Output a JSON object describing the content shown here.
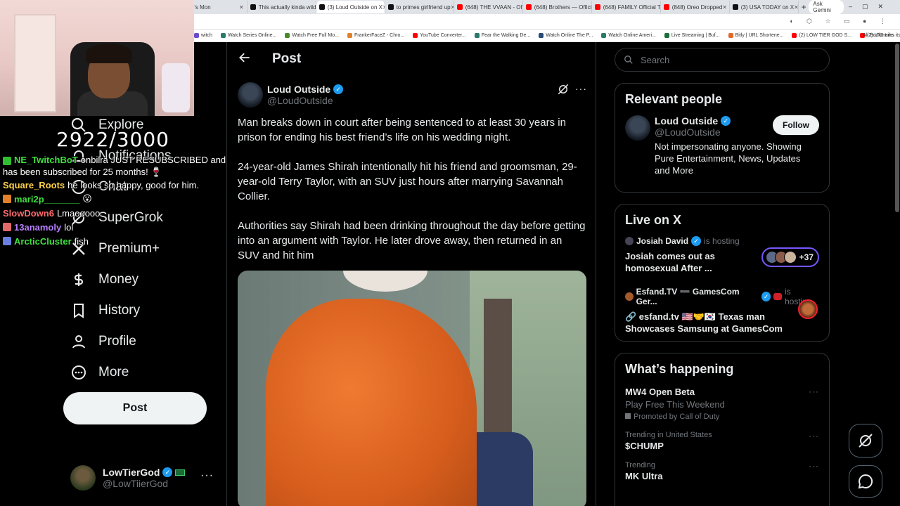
{
  "browser": {
    "tabs": [
      {
        "label": "...'s Mon",
        "color": "#555555"
      },
      {
        "label": "This actually kinda wild",
        "color": "#111111"
      },
      {
        "label": "(3) Loud Outside on X",
        "color": "#111111"
      },
      {
        "label": "to primes girlfriend up",
        "color": "#111111"
      },
      {
        "label": "(648) THE VVAAN - Offi",
        "color": "#ff0000"
      },
      {
        "label": "(648) Brothers — Offici",
        "color": "#ff0000"
      },
      {
        "label": "(648) FAMILY Official Tr",
        "color": "#ff0000"
      },
      {
        "label": "(848) Oreo Dropped",
        "color": "#ff0000"
      },
      {
        "label": "(3) USA TODAY on X",
        "color": "#111111"
      }
    ],
    "ask_gemini": "Ask Gemini",
    "bookmarks": [
      "witch",
      "Watch Series Online...",
      "Watch Free Full Mo...",
      "FrankerFaceZ - Chro...",
      "YouTube Converter...",
      "Fear the Walking De...",
      "Watch Online The P...",
      "Watch Online Ameri...",
      "Live Streaming | Buf...",
      "Bitly | URL Shortene...",
      "(2) LOW TIER GOD S...",
      "(2) LTG tries itslowly..."
    ],
    "all_bookmarks": "All Bookmarks"
  },
  "overlay": {
    "sub_goal": "2922/3000",
    "chat": [
      {
        "user": "NE_TwitchBoT",
        "user_color": "#3fe03f",
        "badge_color": "#2fbf2f",
        "message": "onbilra JUST RESUBSCRIBED and has been subscribed for 25 months! 🍷"
      },
      {
        "user": "Square_Roots",
        "user_color": "#ffd24a",
        "badge_color": "",
        "message": "he looks so happy, good for him."
      },
      {
        "user": "mari2p_______",
        "user_color": "#3fe03f",
        "badge_color": "#e0802a",
        "message": "😮"
      },
      {
        "user": "SlowDown6",
        "user_color": "#ff6b6b",
        "badge_color": "",
        "message": "Lmaooooo"
      },
      {
        "user": "13anamoly",
        "user_color": "#b87fff",
        "badge_color": "#e06a6a",
        "message": "lol"
      },
      {
        "user": "ArcticCluster",
        "user_color": "#3fe03f",
        "badge_color": "#6a7fe0",
        "message": "fish"
      }
    ]
  },
  "nav": {
    "items": [
      {
        "label": "Explore",
        "icon": "search-icon"
      },
      {
        "label": "Notifications",
        "icon": "bell-icon",
        "badge": "3"
      },
      {
        "label": "Chat",
        "icon": "chat-icon"
      },
      {
        "label": "SuperGrok",
        "icon": "grok-icon"
      },
      {
        "label": "Premium+",
        "icon": "x-icon"
      },
      {
        "label": "Money",
        "icon": "money-icon"
      },
      {
        "label": "History",
        "icon": "bookmark-icon"
      },
      {
        "label": "Profile",
        "icon": "person-icon"
      },
      {
        "label": "More",
        "icon": "more-circle-icon"
      }
    ],
    "post_label": "Post",
    "account": {
      "name": "LowTierGod",
      "handle": "@LowTiierGod"
    }
  },
  "main": {
    "title": "Post",
    "post": {
      "author_name": "Loud Outside",
      "author_handle": "@LoudOutside",
      "paragraphs": [
        "Man breaks down in court after being sentenced to at least 30 years in prison for ending his best friend’s life on his wedding night.",
        "24-year-old James Shirah intentionally hit his friend and groomsman, 29-year-old Terry Taylor, with an SUV just hours after marrying Savannah Collier.",
        "Authorities say Shirah had been drinking throughout the day before getting into an argument with Taylor. He later drove away, then returned in an SUV and hit him"
      ]
    }
  },
  "sidebar": {
    "search_placeholder": "Search",
    "relevant": {
      "title": "Relevant people",
      "name": "Loud Outside",
      "handle": "@LoudOutside",
      "bio": "Not impersonating anyone. Showing Pure Entertainment, News, Updates and More",
      "follow_label": "Follow"
    },
    "live": {
      "title": "Live on X",
      "items": [
        {
          "host": "Josiah David",
          "hosting": "is hosting",
          "title": "Josiah comes out as homosexual After ...",
          "count": "+37"
        },
        {
          "host": "Esfand.TV ➖ GamesCom Ger...",
          "hosting": "is hosting",
          "title": "🔗 esfand.tv 🇺🇸🤝🇰🇷 Texas man Showcases Samsung at GamesCom",
          "count": ""
        }
      ]
    },
    "happening": {
      "title": "What’s happening",
      "trends": [
        {
          "meta": "",
          "title": "MW4 Open Beta",
          "sub": "Play Free This Weekend",
          "promo": "Promoted by Call of Duty"
        },
        {
          "meta": "Trending in United States",
          "title": "$CHUMP",
          "sub": "",
          "promo": ""
        },
        {
          "meta": "Trending",
          "title": "MK Ultra",
          "sub": "",
          "promo": ""
        }
      ]
    }
  }
}
